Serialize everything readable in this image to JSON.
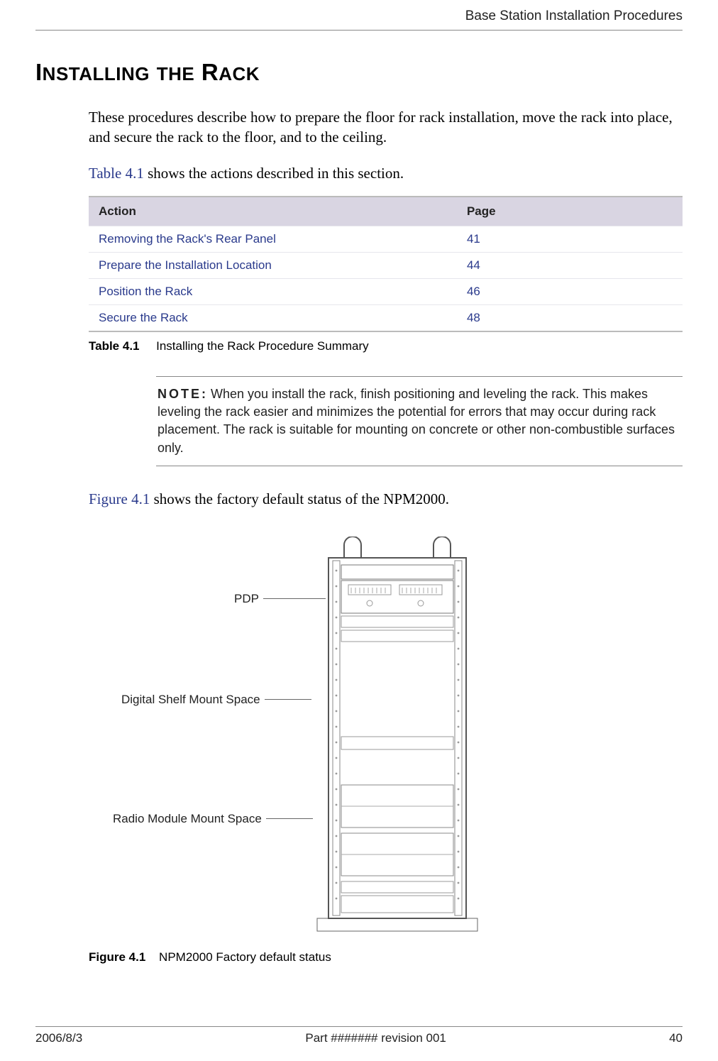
{
  "header": {
    "title": "Base Station Installation Procedures"
  },
  "heading_parts": {
    "p1": "I",
    "p2": "NSTALLING",
    "sp": " ",
    "p3": "THE",
    "sp2": " ",
    "p4": "R",
    "p5": "ACK"
  },
  "intro": "These procedures describe how to prepare the floor for rack installation, move the rack into place, and secure the rack to the floor, and to the ceiling.",
  "intro2_link": "Table 4.1",
  "intro2_rest": " shows the actions described in this section.",
  "table": {
    "col_action": "Action",
    "col_page": "Page",
    "rows": [
      {
        "action": "Removing the Rack's Rear Panel",
        "page": "41"
      },
      {
        "action": "Prepare the Installation Location",
        "page": "44"
      },
      {
        "action": "Position the Rack",
        "page": "46"
      },
      {
        "action": "Secure the Rack",
        "page": "48"
      }
    ],
    "caption_label": "Table 4.1",
    "caption_text": "Installing the Rack Procedure Summary"
  },
  "note": {
    "label": "NOTE:",
    "text": "When you install the rack, finish positioning and leveling the rack. This makes leveling the rack easier and minimizes the potential for errors that may occur during rack placement. The rack is suitable for mounting on concrete or other non-combustible surfaces only."
  },
  "figure_intro_link": "Figure 4.1",
  "figure_intro_rest": " shows the factory default status of the NPM2000.",
  "figure": {
    "callout1": "PDP",
    "callout2": "Digital Shelf Mount Space",
    "callout3": "Radio Module Mount Space",
    "caption_label": "Figure 4.1",
    "caption_text": "NPM2000 Factory default status"
  },
  "footer": {
    "left": "2006/8/3",
    "center": "Part ####### revision 001",
    "right": "40"
  }
}
